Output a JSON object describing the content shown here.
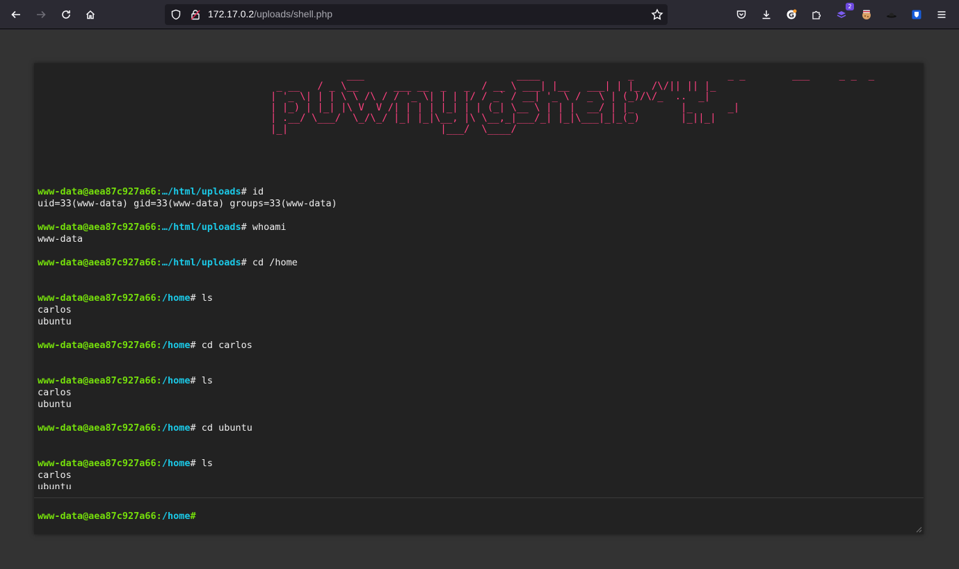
{
  "browser": {
    "url_host": "172.17.0.2",
    "url_path": "/uploads/shell.php",
    "ext_badge_count": "2"
  },
  "banner": {
    "ascii": "             ___                          ____               _                _ _        ___     _ _  _\n _ __   / _ \\__      ___ __  _   _  / __ \\ ___| |__   ___| | |_  /\\/|| || |_\n| '_ \\| | | \\ \\ /\\ / / '_ \\| | | |/ / _` / __| '_ \\ / _ \\ | (_)/\\/_  ..  _|\n| |_) | |_| |\\ V  V /| | | | |_| | | (_| \\__ \\ | | |  __/ | |_        |_      _|\n| .__/ \\___/  \\_/\\_/ |_| |_|\\__, |\\ \\__,_|___/_| |_|\\___|_|_(_)       |_||_|\n|_|                          |___/  \\____/"
  },
  "terminal": {
    "entries": [
      {
        "user": "www-data@aea87c927a66:",
        "path": "…/html/uploads",
        "cmd": "# id",
        "output": [
          "uid=33(www-data) gid=33(www-data) groups=33(www-data)"
        ]
      },
      {
        "user": "www-data@aea87c927a66:",
        "path": "…/html/uploads",
        "cmd": "# whoami",
        "output": [
          "www-data"
        ]
      },
      {
        "user": "www-data@aea87c927a66:",
        "path": "…/html/uploads",
        "cmd": "# cd /home",
        "output": [
          ""
        ]
      },
      {
        "user": "www-data@aea87c927a66:",
        "path": "/home",
        "cmd": "# ls",
        "output": [
          "carlos",
          "ubuntu"
        ]
      },
      {
        "user": "www-data@aea87c927a66:",
        "path": "/home",
        "cmd": "# cd carlos",
        "output": [
          ""
        ]
      },
      {
        "user": "www-data@aea87c927a66:",
        "path": "/home",
        "cmd": "# ls",
        "output": [
          "carlos",
          "ubuntu"
        ]
      },
      {
        "user": "www-data@aea87c927a66:",
        "path": "/home",
        "cmd": "# cd ubuntu",
        "output": [
          ""
        ]
      },
      {
        "user": "www-data@aea87c927a66:",
        "path": "/home",
        "cmd": "# ls",
        "output": [
          "carlos",
          "ubuntu"
        ]
      }
    ],
    "input_prompt": {
      "user": "www-data@aea87c927a66:",
      "path": "/home",
      "suffix": "#",
      "value": ""
    }
  },
  "colors": {
    "banner": "#ff4180",
    "prompt_user": "#75df0b",
    "prompt_path": "#1bc9e7"
  }
}
